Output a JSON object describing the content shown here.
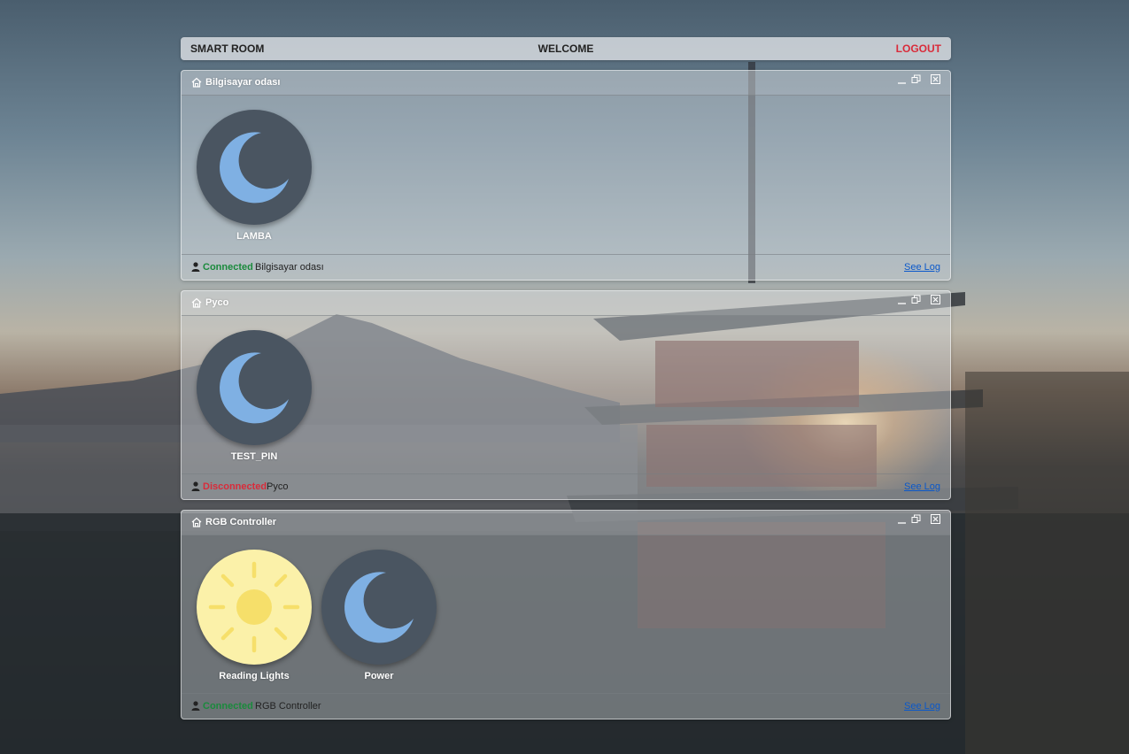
{
  "navbar": {
    "brand": "SMART ROOM",
    "welcome": "WELCOME",
    "logout": "LOGOUT"
  },
  "rooms": [
    {
      "title": "Bilgisayar odası",
      "status": "Connected",
      "status_color": "#1a8a3c",
      "footer_name": "Bilgisayar odası",
      "see_log": "See Log",
      "devices": [
        {
          "label": "LAMBA",
          "state": "off",
          "icon": "moon-icon"
        }
      ]
    },
    {
      "title": "Pyco",
      "status": "Disconnected",
      "status_color": "#d92b3a",
      "footer_name": "Pyco",
      "see_log": "See Log",
      "devices": [
        {
          "label": "TEST_PIN",
          "state": "off",
          "icon": "moon-icon"
        }
      ]
    },
    {
      "title": "RGB Controller",
      "status": "Connected",
      "status_color": "#1a8a3c",
      "footer_name": "RGB Controller",
      "see_log": "See Log",
      "devices": [
        {
          "label": "Reading Lights",
          "state": "on",
          "icon": "sun-icon"
        },
        {
          "label": "Power",
          "state": "off",
          "icon": "moon-icon"
        }
      ]
    }
  ],
  "colors": {
    "device_off_bg": "#4a5561",
    "moon": "#7fb0e3",
    "device_on_bg": "#fbf1a9",
    "sun": "#f6df6a",
    "logout": "#d92b3a",
    "link": "#0a58ca"
  }
}
